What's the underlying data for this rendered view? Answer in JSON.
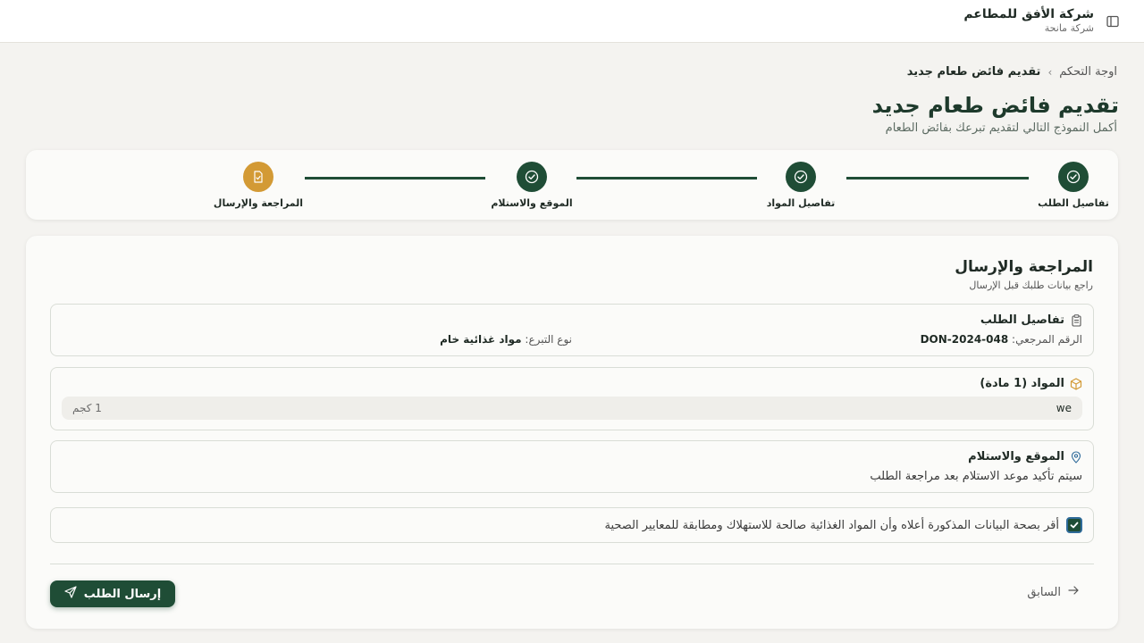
{
  "header": {
    "company_name": "شركة الأفق للمطاعم",
    "company_type": "شركة مانحة",
    "sidebar_toggle_icon": "sidebar-panel-icon"
  },
  "breadcrumb": {
    "home": "اوجة التحكم",
    "separator": "›",
    "current": "تقديم فائض طعام جديد"
  },
  "page": {
    "title": "تقديم فائض طعام جديد",
    "subtitle": "أكمل النموذج التالي لتقديم تبرعك بفائض الطعام"
  },
  "stepper": {
    "steps": [
      {
        "label": "تفاصيل الطلب",
        "state": "done",
        "icon": "check-circle-icon"
      },
      {
        "label": "تفاصيل المواد",
        "state": "done",
        "icon": "check-circle-icon"
      },
      {
        "label": "الموقع والاستلام",
        "state": "done",
        "icon": "check-circle-icon"
      },
      {
        "label": "المراجعة والإرسال",
        "state": "active",
        "icon": "document-check-icon"
      }
    ]
  },
  "review": {
    "title": "المراجعة والإرسال",
    "subtitle": "راجع بيانات طلبك قبل الإرسال",
    "request_details": {
      "title": "تفاصيل الطلب",
      "icon": "clipboard-icon",
      "reference_label": "الرقم المرجعي:",
      "reference_value": "DON-2024-048",
      "donation_type_label": "نوع التبرع:",
      "donation_type_value": "مواد غذائية خام"
    },
    "items": {
      "title": "المواد (1 مادة)",
      "icon": "package-icon",
      "rows": [
        {
          "name": "we",
          "quantity": "1 كجم"
        }
      ]
    },
    "location": {
      "title": "الموقع والاستلام",
      "icon": "map-pin-icon",
      "text": "سيتم تأكيد موعد الاستلام بعد مراجعة الطلب"
    },
    "confirmation": {
      "checked": true,
      "text": "أقر بصحة البيانات المذكورة أعلاه وأن المواد الغذائية صالحة للاستهلاك ومطابقة للمعايير الصحية"
    }
  },
  "actions": {
    "submit_label": "إرسال الطلب",
    "previous_label": "السابق"
  },
  "colors": {
    "primary": "#1f4d36",
    "accent": "#d39a35",
    "background": "#f4f3f0"
  }
}
